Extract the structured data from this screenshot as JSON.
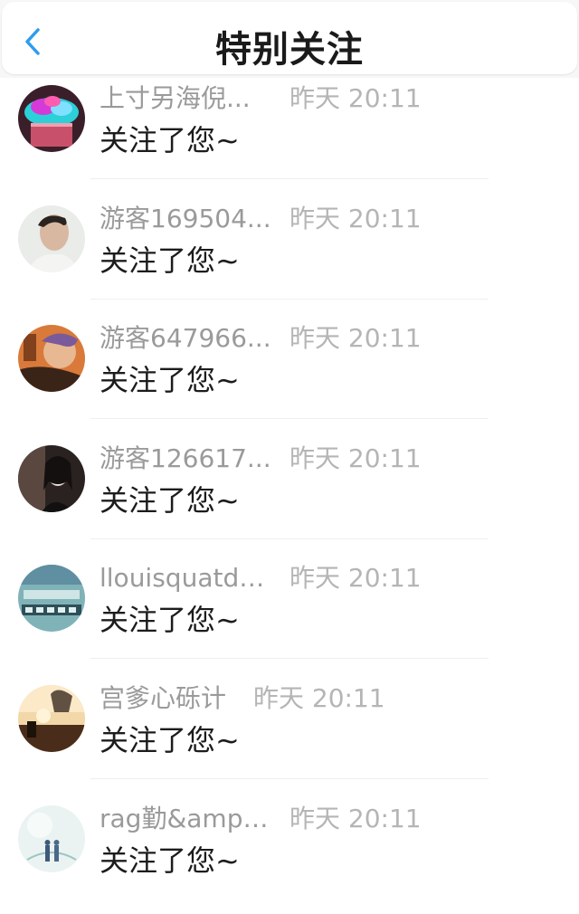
{
  "header": {
    "title": "特别关注"
  },
  "rows": [
    {
      "name": "上寸另海倪...",
      "time": "昨天 20:11",
      "message": "关注了您~"
    },
    {
      "name": "游客169504...",
      "time": "昨天 20:11",
      "message": "关注了您~"
    },
    {
      "name": "游客647966...",
      "time": "昨天 20:11",
      "message": "关注了您~"
    },
    {
      "name": "游客126617...",
      "time": "昨天 20:11",
      "message": "关注了您~"
    },
    {
      "name": "llouisquatdo...",
      "time": "昨天 20:11",
      "message": "关注了您~"
    },
    {
      "name": "宫爹心砾计",
      "time": "昨天 20:11",
      "message": "关注了您~"
    },
    {
      "name": "rag勤&amp;...",
      "time": "昨天 20:11",
      "message": "关注了您~"
    }
  ],
  "colors": {
    "accent": "#2d9cf0",
    "name_text": "#9a9a9a",
    "time_text": "#b5b5b5"
  }
}
